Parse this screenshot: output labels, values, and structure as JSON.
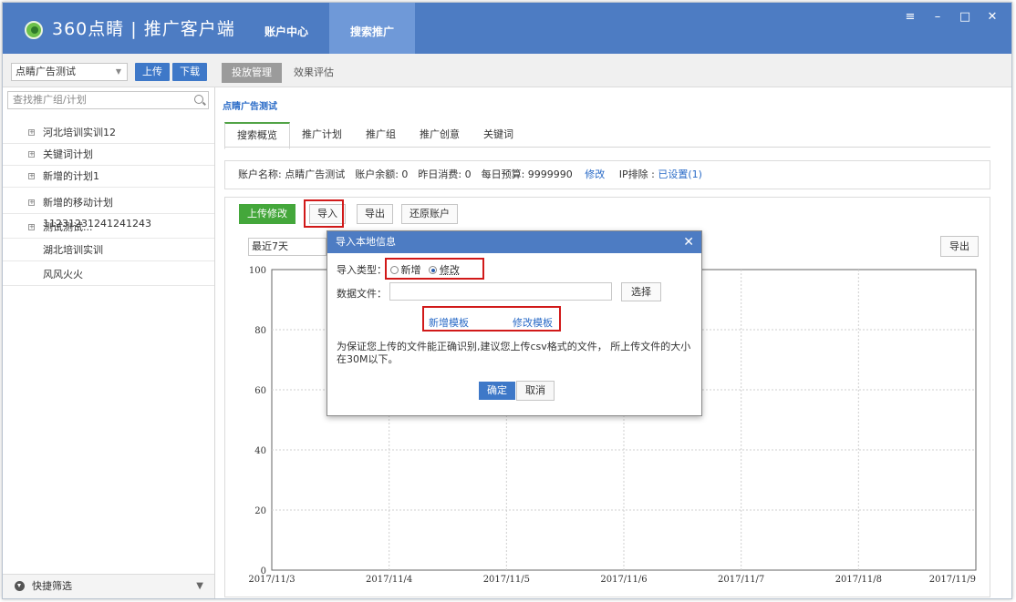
{
  "app": {
    "logo_text": "360点睛 | 推广客户端",
    "nav_tabs": [
      "账户中心",
      "搜索推广"
    ],
    "window_controls": [
      "≡",
      "–",
      "□",
      "✕"
    ]
  },
  "sidebar": {
    "account_select": "点睛广告测试",
    "upload_label": "上传",
    "download_label": "下载",
    "search_placeholder": "查找推广组/计划",
    "items": [
      {
        "label": "河北培训实训12",
        "expand": "+"
      },
      {
        "label": "关键词计划",
        "expand": "+"
      },
      {
        "label": "新增的计划1",
        "expand": "+"
      },
      {
        "label": "新增的移动计划11231231241241243",
        "expand": "+"
      },
      {
        "label": "测试测试...",
        "expand": "+"
      },
      {
        "label": "湖北培训实训",
        "expand": ""
      },
      {
        "label": "风风火火",
        "expand": ""
      }
    ],
    "quick_filter": "快捷筛选"
  },
  "subtabs": [
    "投放管理",
    "效果评估"
  ],
  "main": {
    "breadcrumb": "点睛广告测试",
    "tabs": [
      "搜索概览",
      "推广计划",
      "推广组",
      "推广创意",
      "关键词"
    ],
    "info": {
      "text": "账户名称: 点睛广告测试　账户余额: 0　昨日消费: 0　每日预算: 9999990",
      "edit_link": "修改",
      "ip_label": "IP排除 : ",
      "ip_link": "已设置(1)"
    },
    "buttons": {
      "upload_changes": "上传修改",
      "import": "导入",
      "export": "导出",
      "restore": "还原账户",
      "chart_export": "导出"
    },
    "range_select": "最近7天"
  },
  "chart_data": {
    "type": "line",
    "x": [
      "2017/11/3",
      "2017/11/4",
      "2017/11/5",
      "2017/11/6",
      "2017/11/7",
      "2017/11/8",
      "2017/11/9"
    ],
    "yticks": [
      "100",
      "80",
      "60",
      "40",
      "20",
      "0"
    ],
    "ylim": [
      0,
      100
    ],
    "grid": true,
    "series": []
  },
  "dialog": {
    "title": "导入本地信息",
    "close": "✕",
    "type_label": "导入类型：",
    "option_new": "新增",
    "option_modify": "修改",
    "selected": "修改",
    "file_label": "数据文件：",
    "choose_label": "选择",
    "template_new": "新增模板",
    "template_modify": "修改模板",
    "hint": "为保证您上传的文件能正确识别,建议您上传csv格式的文件， 所上传文件的大小在30M以下。",
    "ok": "确定",
    "cancel": "取消"
  },
  "colors": {
    "titlebar": "#4d7cc3",
    "accent_blue": "#3e78c8",
    "accent_green": "#44a73b",
    "highlight_red": "#d11919"
  }
}
